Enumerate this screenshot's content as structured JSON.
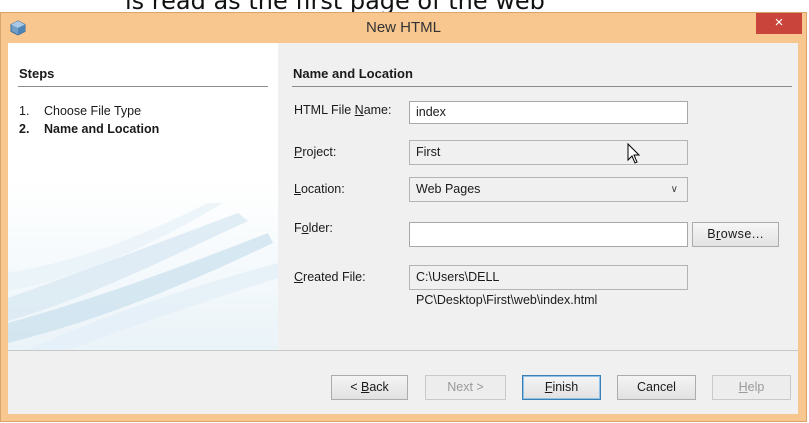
{
  "background_caption": "is read as the first page of the web",
  "window": {
    "title": "New HTML",
    "close_glyph": "×",
    "icon": "netbeans-cube-icon"
  },
  "steps": {
    "title": "Steps",
    "items": [
      {
        "num": "1.",
        "label": "Choose File Type"
      },
      {
        "num": "2.",
        "label": "Name and Location"
      }
    ]
  },
  "section": {
    "title": "Name and Location"
  },
  "form": {
    "file_name": {
      "label_pre": "HTML File ",
      "label_mn": "N",
      "label_post": "ame:",
      "value": "index"
    },
    "project": {
      "label_pre": "",
      "label_mn": "P",
      "label_post": "roject:",
      "value": "First"
    },
    "location": {
      "label_pre": "",
      "label_mn": "L",
      "label_post": "ocation:",
      "value": "Web Pages"
    },
    "folder": {
      "label_pre": "F",
      "label_mn": "o",
      "label_post": "lder:",
      "value": ""
    },
    "browse": {
      "pre": "B",
      "mn": "r",
      "post": "owse..."
    },
    "created_file": {
      "label_pre": "",
      "label_mn": "C",
      "label_post": "reated File:",
      "value": "C:\\Users\\DELL PC\\Desktop\\First\\web\\index.html"
    }
  },
  "buttons": {
    "back": {
      "pre": "< ",
      "mn": "B",
      "post": "ack"
    },
    "next": {
      "label": "Next >"
    },
    "finish": {
      "pre": "",
      "mn": "F",
      "post": "inish"
    },
    "cancel": {
      "label": "Cancel"
    },
    "help": {
      "pre": "",
      "mn": "H",
      "post": "elp"
    }
  },
  "colors": {
    "frame": "#f7c78f",
    "close": "#c9453b",
    "panel": "#f0f0f0"
  }
}
